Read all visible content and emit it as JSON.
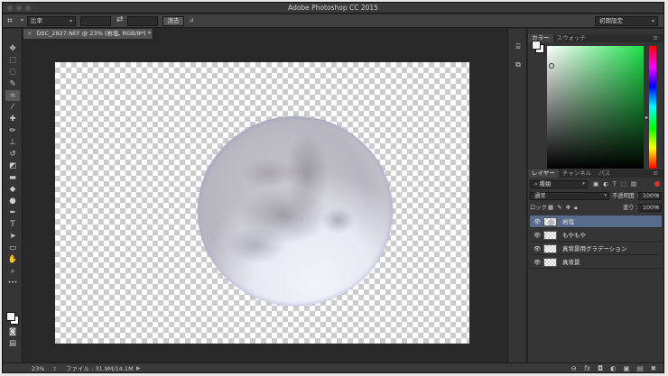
{
  "window": {
    "title": "Adobe Photoshop CC 2015"
  },
  "options_bar": {
    "tool_icon": "crop-icon",
    "ratio_label": "比率",
    "clear_button": "消去",
    "preset_label": "初期設定"
  },
  "document": {
    "tab_title": "DSC_2927.NEF @ 23% (岩塩, RGB/8*) *",
    "close_glyph": "×"
  },
  "tools": [
    "move-icon",
    "marquee-icon",
    "lasso-icon",
    "quick-select-icon",
    "crop-icon",
    "eyedropper-icon",
    "healing-brush-icon",
    "brush-icon",
    "clone-stamp-icon",
    "history-brush-icon",
    "eraser-icon",
    "gradient-icon",
    "blur-icon",
    "dodge-icon",
    "pen-icon",
    "type-icon",
    "path-select-icon",
    "rectangle-icon",
    "hand-icon",
    "zoom-icon"
  ],
  "status_bar": {
    "zoom": "23%",
    "file_info": "ファイル : 31.9M/14.1M",
    "arrow": "▶"
  },
  "color_panel": {
    "tabs": [
      "カラー",
      "スウォッチ"
    ],
    "menu_glyph": "≡",
    "foreground": "#f2f2f2",
    "background": "#ffffff",
    "hue_color": "#1ee04a"
  },
  "layers_panel": {
    "tabs": [
      "レイヤー",
      "チャンネル",
      "パス"
    ],
    "menu_glyph": "≡",
    "filter_kind": "種類",
    "blend_mode": "通常",
    "opacity_label": "不透明度 :",
    "opacity_value": "100%",
    "lock_label": "ロック :",
    "fill_label": "塗り :",
    "fill_value": "100%",
    "footer_icons": "⊖ fx ◘ ◐ ▣ ▤ 🗑",
    "layers": [
      {
        "name": "岩塩",
        "visible": true,
        "selected": true,
        "has_content": true
      },
      {
        "name": "もやもや",
        "visible": true,
        "selected": false,
        "has_content": false
      },
      {
        "name": "真背景用グラデーション",
        "visible": true,
        "selected": false,
        "has_content": false
      },
      {
        "name": "真背景",
        "visible": true,
        "selected": false,
        "has_content": false
      }
    ]
  }
}
